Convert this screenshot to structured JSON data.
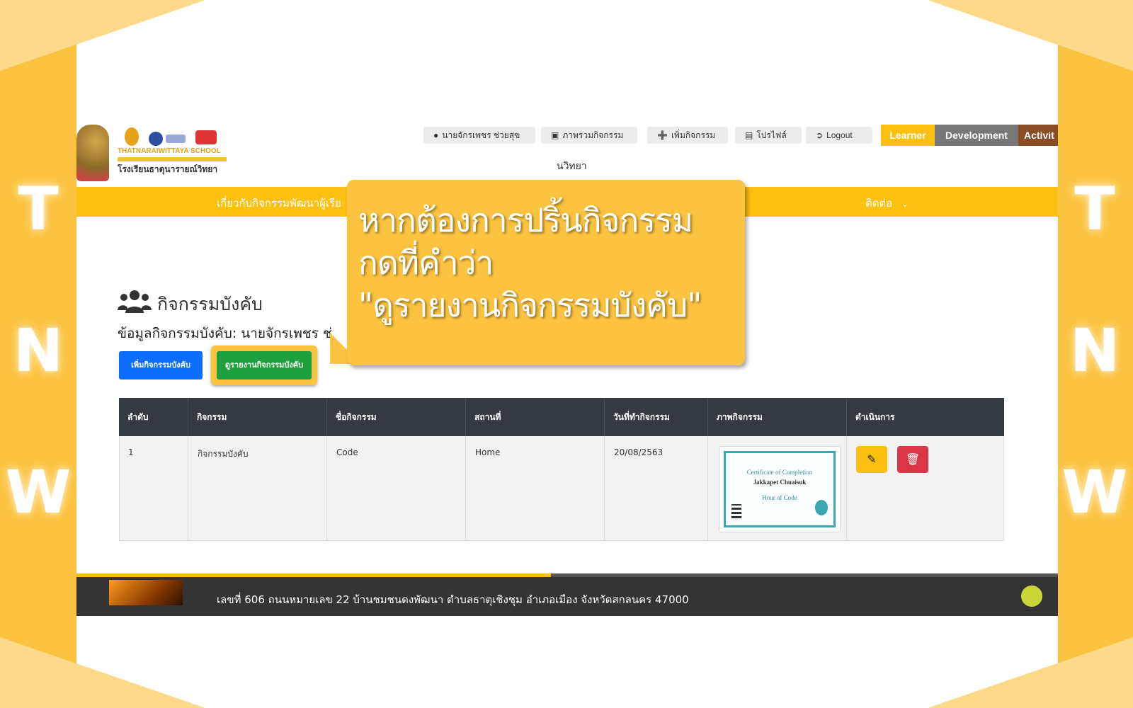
{
  "frame": {
    "accent_color": "#fcc340",
    "left_letters": [
      "T",
      "N",
      "W"
    ],
    "right_letters": [
      "T",
      "N",
      "W"
    ]
  },
  "header": {
    "school_name_en": "THATNARAIWITTAYA SCHOOL",
    "school_name_th": "โรงเรียนธาตุนารายณ์วิทยา",
    "top_buttons": [
      {
        "label": "นายจักรเพชร ช่วยสุข",
        "icon": "user-icon"
      },
      {
        "label": "ภาพรวมกิจกรรม",
        "icon": "images-icon"
      },
      {
        "label": "เพิ่มกิจกรรม",
        "icon": "plus-circle-icon"
      },
      {
        "label": "โปรไฟล์",
        "icon": "id-card-icon"
      },
      {
        "label": "Logout",
        "icon": "sign-out-icon"
      }
    ],
    "brand_tabs": [
      {
        "label": "Learner",
        "color": "#fcc012"
      },
      {
        "label": "Development",
        "color": "#777777"
      },
      {
        "label": "Activit",
        "color": "#8a4b27"
      }
    ],
    "subtitle": "นวิทยา"
  },
  "nav": {
    "items": [
      "เกี่ยวกับกิจกรรมพัฒนาผู้เรีย",
      "ติดต่อ"
    ]
  },
  "main": {
    "title": "กิจกรรมบังคับ",
    "info": "ข้อมูลกิจกรรมบังคับ: นายจักรเพชร ช่",
    "add_button": "เพิ่มกิจกรรมบังคับ",
    "report_button": "ดูรายงานกิจกรรมบังคับ"
  },
  "table": {
    "headers": [
      "ลำดับ",
      "กิจกรรม",
      "ชื่อกิจกรรม",
      "สถานที่",
      "วันที่ทำกิจกรรม",
      "ภาพกิจกรรม",
      "ดำเนินการ"
    ],
    "rows": [
      {
        "no": "1",
        "activity": "กิจกรรมบังคับ",
        "name": "Code",
        "place": "Home",
        "date": "20/08/2563",
        "image": {
          "title": "Certificate of Completion",
          "recipient": "Jakkapet Chuaisuk",
          "course": "Hour of Code"
        }
      }
    ]
  },
  "footer": {
    "address": "เลขที่ 606 ถนนหมายเลข 22 บ้านชมชนดงพัฒนา ตำบลธาตุเชิงชุม อำเภอเมือง จังหวัดสกลนคร 47000"
  },
  "callout": {
    "lines": [
      "หากต้องการปริ้นกิจกรรม",
      "กดที่คำว่า",
      "\"ดูรายงานกิจกรรมบังคับ\""
    ]
  }
}
